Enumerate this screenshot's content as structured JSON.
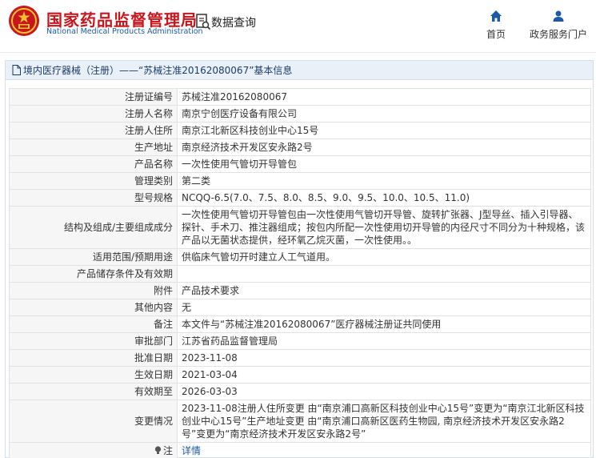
{
  "header": {
    "brand_cn": "国家药品监督管理局",
    "brand_en": "National Medical Products Administration",
    "query_label": "数据查询",
    "nav": {
      "home": "首页",
      "portal": "政务服务门户"
    }
  },
  "panel": {
    "title": "境内医疗器械（注册）——“苏械注准20162080067”基本信息"
  },
  "rows": [
    {
      "label": "注册证编号",
      "value": "苏械注准20162080067"
    },
    {
      "label": "注册人名称",
      "value": "南京宁创医疗设备有限公司"
    },
    {
      "label": "注册人住所",
      "value": "南京江北新区科技创业中心15号"
    },
    {
      "label": "生产地址",
      "value": "南京经济技术开发区安永路2号"
    },
    {
      "label": "产品名称",
      "value": "一次性使用气管切开导管包"
    },
    {
      "label": "管理类别",
      "value": "第二类"
    },
    {
      "label": "型号规格",
      "value": "NCQQ-6.5(7.0、7.5、8.0、8.5、9.0、9.5、10.0、10.5、11.0)"
    },
    {
      "label": "结构及组成/主要组成成分",
      "value": "一次性使用气管切开导管包由一次性使用气管切开导管、旋转扩张器、J型导丝、插入引导器、探针、手术刀、推注器组成；按包内所配一次性使用切开导管的内径尺寸不同分为十种规格，该产品以无菌状态提供，经环氧乙烷灭菌，一次性使用。。"
    },
    {
      "label": "适用范围/预期用途",
      "value": "供临床气管切开时建立人工气道用。"
    },
    {
      "label": "产品储存条件及有效期",
      "value": ""
    },
    {
      "label": "附件",
      "value": "产品技术要求"
    },
    {
      "label": "其他内容",
      "value": "无"
    },
    {
      "label": "备注",
      "value": "本文件与“苏械注准20162080067”医疗器械注册证共同使用"
    },
    {
      "label": "审批部门",
      "value": "江苏省药品监督管理局"
    },
    {
      "label": "批准日期",
      "value": "2023-11-08"
    },
    {
      "label": "生效日期",
      "value": "2021-03-04"
    },
    {
      "label": "有效期至",
      "value": "2026-03-03"
    },
    {
      "label": "变更情况",
      "value": "2023-11-08注册人住所变更 由“南京浦口高新区科技创业中心15号”变更为“南京江北新区科技创业中心15号”生产地址变更 由“南京浦口高新区医药生物园, 南京经济技术开发区安永路2号”变更为“南京经济技术开发区安永路2号”"
    },
    {
      "label": "注",
      "value": "详情"
    }
  ],
  "colors": {
    "brand_red": "#c8161d",
    "brand_blue": "#1a5aa8",
    "link": "#1a5aa8"
  },
  "icons": [
    "national-emblem-icon",
    "query-doc-icon",
    "home-icon",
    "user-icon",
    "doc-icon",
    "bulb-icon"
  ]
}
